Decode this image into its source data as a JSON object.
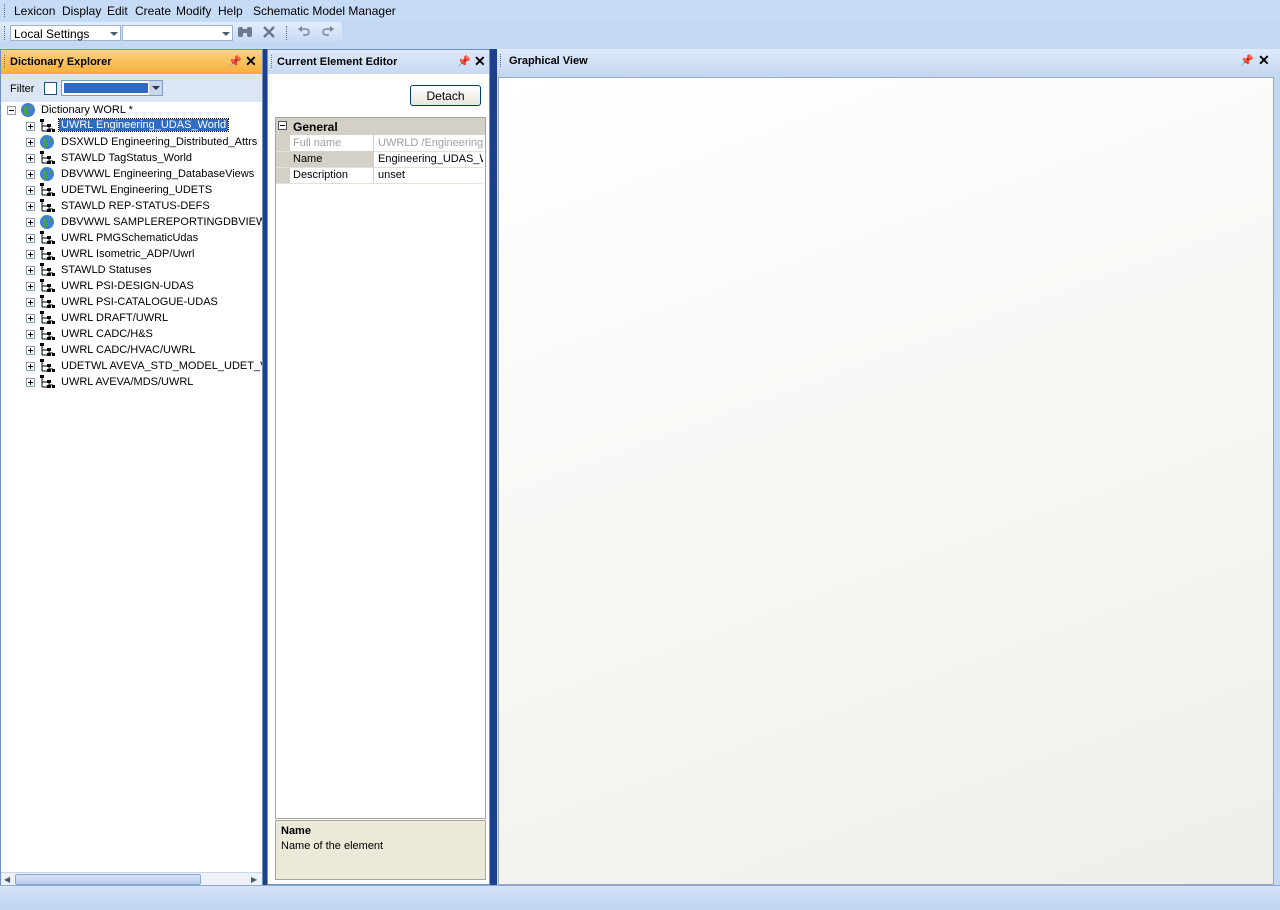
{
  "menu": [
    "Lexicon",
    "Display",
    "Edit",
    "Create",
    "Modify",
    "Help",
    "Schematic Model Manager"
  ],
  "toolbar": {
    "settings_value": "Local Settings",
    "second_value": ""
  },
  "explorer": {
    "title": "Dictionary Explorer",
    "filter_label": "Filter",
    "root": "Dictionary WORL *",
    "items": [
      {
        "label": "UWRL Engineering_UDAS_World",
        "icon": "tree-icon",
        "selected": true
      },
      {
        "label": "DSXWLD Engineering_Distributed_Attrs",
        "icon": "globe-icon"
      },
      {
        "label": "STAWLD TagStatus_World",
        "icon": "tree-icon"
      },
      {
        "label": "DBVWWL Engineering_DatabaseViews",
        "icon": "globe-icon"
      },
      {
        "label": "UDETWL Engineering_UDETS",
        "icon": "tree-icon"
      },
      {
        "label": "STAWLD REP-STATUS-DEFS",
        "icon": "tree-icon"
      },
      {
        "label": "DBVWWL SAMPLEREPORTINGDBVIEW",
        "icon": "globe-icon"
      },
      {
        "label": "UWRL PMGSchematicUdas",
        "icon": "tree-icon"
      },
      {
        "label": "UWRL Isometric_ADP/Uwrl",
        "icon": "tree-icon"
      },
      {
        "label": "STAWLD Statuses",
        "icon": "tree-icon"
      },
      {
        "label": "UWRL PSI-DESIGN-UDAS",
        "icon": "tree-icon"
      },
      {
        "label": "UWRL PSI-CATALOGUE-UDAS",
        "icon": "tree-icon"
      },
      {
        "label": "UWRL DRAFT/UWRL",
        "icon": "tree-icon"
      },
      {
        "label": "UWRL CADC/H&S",
        "icon": "tree-icon"
      },
      {
        "label": "UWRL CADC/HVAC/UWRL",
        "icon": "tree-icon"
      },
      {
        "label": "UDETWL AVEVA_STD_MODEL_UDET_V",
        "icon": "tree-icon"
      },
      {
        "label": "UWRL AVEVA/MDS/UWRL",
        "icon": "tree-icon"
      }
    ]
  },
  "editor": {
    "title": "Current Element Editor",
    "detach_label": "Detach",
    "category": "General",
    "properties": [
      {
        "key": "Full name",
        "value": "UWRLD /Engineering",
        "disabled": true
      },
      {
        "key": "Name",
        "value": "Engineering_UDAS_W"
      },
      {
        "key": "Description",
        "value": "unset"
      }
    ],
    "help_title": "Name",
    "help_text": "Name of the element"
  },
  "graphical": {
    "title": "Graphical View"
  },
  "colors": {
    "active_header": "#f9b347",
    "selection": "#316ac5",
    "chrome": "#c4d8f1"
  }
}
